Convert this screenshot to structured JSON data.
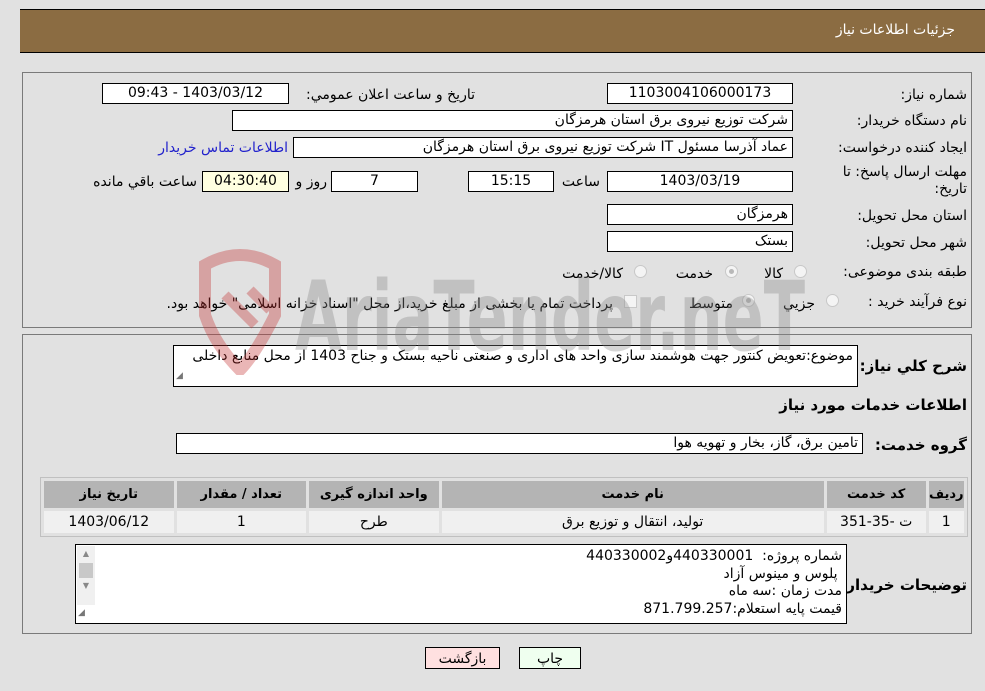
{
  "header": {
    "title": "جزئیات اطلاعات نیاز"
  },
  "fields": {
    "need_number_label": "شماره نیاز:",
    "need_number": "1103004106000173",
    "announce_label": "تاریخ و ساعت اعلان عمومي:",
    "announce_value": "1403/03/12 - 09:43",
    "buyer_org_label": "نام دستگاه خریدار:",
    "buyer_org": "شرکت توزیع نیروی برق استان هرمزگان",
    "creator_label": "ایجاد کننده درخواست:",
    "creator": "عماد آذرسا مسئول IT شرکت توزیع نیروی برق استان هرمزگان",
    "contact_link": "اطلاعات تماس خریدار",
    "deadline_label_line1": "مهلت ارسال پاسخ: تا",
    "deadline_label_line2": "تاریخ:",
    "deadline_date": "1403/03/19",
    "time_label": "ساعت",
    "deadline_time": "15:15",
    "days_value": "7",
    "days_label": "روز و",
    "remaining_time": "04:30:40",
    "remaining_label": "ساعت باقي مانده",
    "province_label": "استان محل تحویل:",
    "province": "هرمزگان",
    "city_label": "شهر محل تحویل:",
    "city": "بستک",
    "category_label": "طبقه بندی موضوعی:",
    "category_options": [
      {
        "label": "کالا",
        "checked": false
      },
      {
        "label": "خدمت",
        "checked": true
      },
      {
        "label": "کالا/خدمت",
        "checked": false
      }
    ],
    "process_label": "نوع فرآیند خرید :",
    "process_options": [
      {
        "label": "جزیي",
        "checked": false
      },
      {
        "label": "متوسط",
        "checked": true
      }
    ],
    "treasury_note": "پرداخت تمام یا بخشی از مبلغ خرید،از محل \"اسناد خزانه اسلامی\" خواهد بود."
  },
  "description": {
    "label": "شرح کلي نیاز:",
    "text": "موضوع:تعویض کنتور جهت هوشمند سازی واحد های اداری و صنعتی ناحیه بستک و جناح 1403 از محل منابع داخلی"
  },
  "services": {
    "section_title": "اطلاعات خدمات مورد نیاز",
    "group_label": "گروه خدمت:",
    "group_value": "تامین برق، گاز، بخار و تهویه هوا",
    "table": {
      "headers": [
        "ردیف",
        "کد خدمت",
        "نام خدمت",
        "واحد اندازه گیری",
        "تعداد / مقدار",
        "تاریخ نیاز"
      ],
      "rows": [
        [
          "1",
          "ت -35-351",
          "تولید، انتقال و توزیع برق",
          "طرح",
          "1",
          "1403/06/12"
        ]
      ]
    }
  },
  "buyer_notes": {
    "label": "توضیحات خریدار:",
    "lines": [
      "شماره پروژه:  440330001و440330002",
      " پلوس و مینوس آزاد",
      "مدت زمان :سه ماه",
      "قیمت پایه استعلام:871.799.257"
    ]
  },
  "buttons": {
    "print": "چاپ",
    "back": "بازگشت"
  },
  "watermark": {
    "text": "AriaTender.neT"
  },
  "colors": {
    "header_bg": "#8b6c42",
    "print_bg": "#efffef",
    "back_bg": "#ffe0e0",
    "remaining_bg": "#ffffe0",
    "link": "#2222cc"
  }
}
